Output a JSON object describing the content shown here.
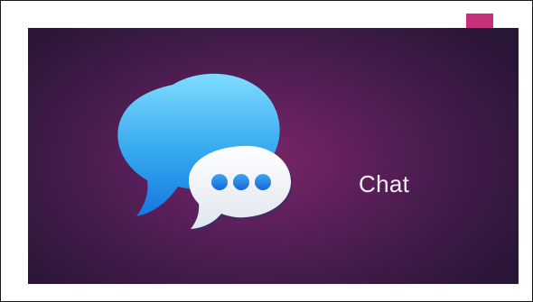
{
  "slide": {
    "title": "Chat",
    "background_color": "#5a1f5a",
    "accent_color": "#c6317a",
    "icon": "messages-chat-bubbles-icon"
  }
}
